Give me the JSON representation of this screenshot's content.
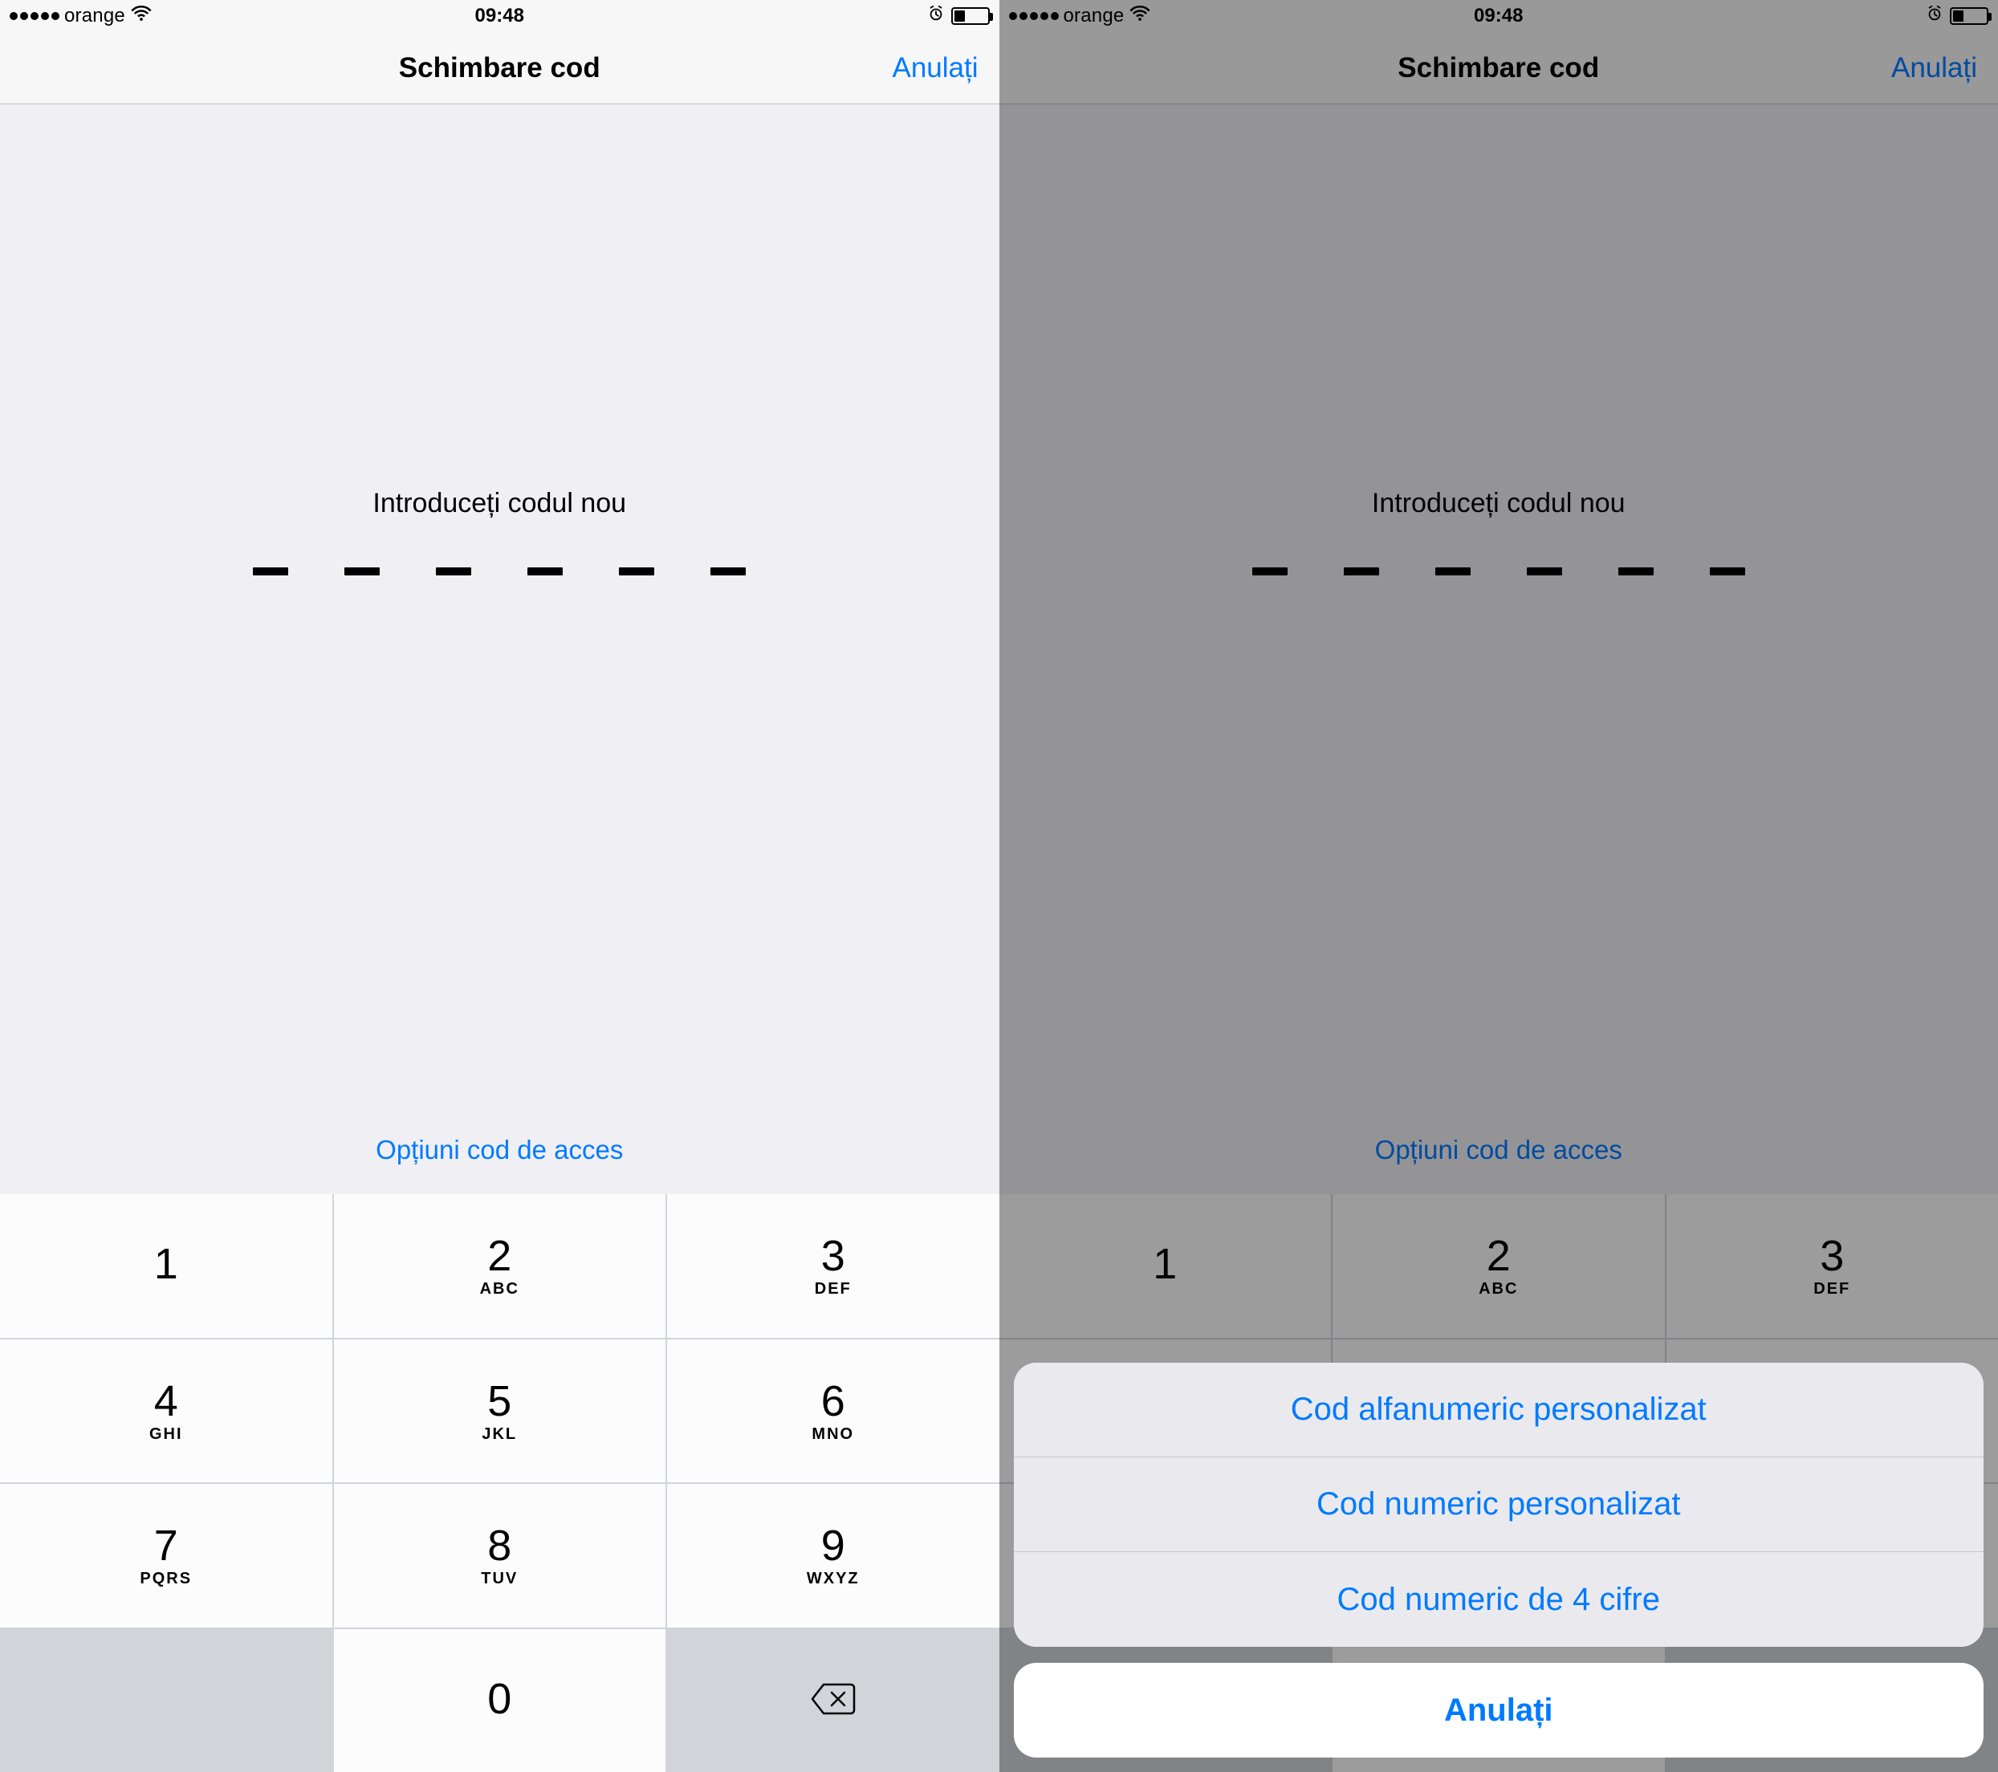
{
  "status": {
    "carrier": "orange",
    "time": "09:48"
  },
  "nav": {
    "title": "Schimbare cod",
    "cancel": "Anulați"
  },
  "prompt": "Introduceți codul nou",
  "options": "Opțiuni cod de acces",
  "keys": {
    "k1": {
      "digit": "1",
      "letters": ""
    },
    "k2": {
      "digit": "2",
      "letters": "ABC"
    },
    "k3": {
      "digit": "3",
      "letters": "DEF"
    },
    "k4": {
      "digit": "4",
      "letters": "GHI"
    },
    "k5": {
      "digit": "5",
      "letters": "JKL"
    },
    "k6": {
      "digit": "6",
      "letters": "MNO"
    },
    "k7": {
      "digit": "7",
      "letters": "PQRS"
    },
    "k8": {
      "digit": "8",
      "letters": "TUV"
    },
    "k9": {
      "digit": "9",
      "letters": "WXYZ"
    },
    "k0": {
      "digit": "0",
      "letters": ""
    }
  },
  "sheet": {
    "opt1": "Cod alfanumeric personalizat",
    "opt2": "Cod numeric personalizat",
    "opt3": "Cod numeric de 4 cifre",
    "cancel": "Anulați"
  }
}
